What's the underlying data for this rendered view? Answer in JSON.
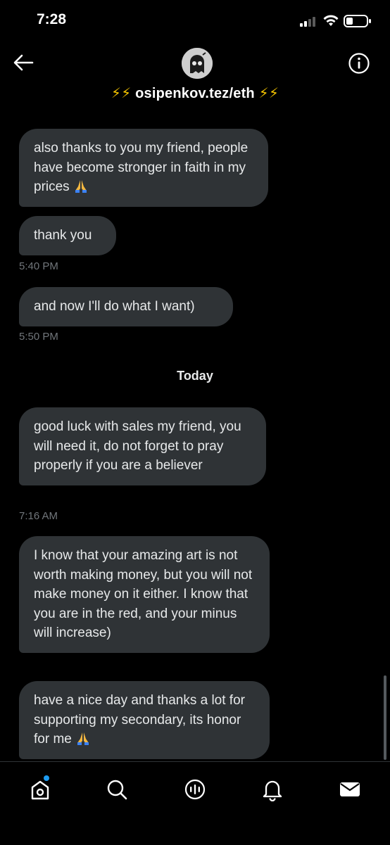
{
  "status_bar": {
    "time": "7:28"
  },
  "header": {
    "back_icon": "arrow-left-icon",
    "info_icon": "info-circle-icon",
    "title_emoji_left": "⚡⚡",
    "title_handle": "osipenkov.tez/eth",
    "title_emoji_right": "⚡⚡"
  },
  "messages": [
    {
      "text": "also thanks to you my friend, people have become stronger in faith in my prices",
      "emoji": "pray"
    },
    {
      "text": "thank you"
    },
    {
      "text": "and now I'll do what I want)"
    },
    {
      "text": "good luck with sales my friend, you will need it, do not forget to pray properly if you are a believer"
    },
    {
      "text": "I know that your amazing art is not worth making money, but you will not make money on it either. I know that you are in the red, and your minus will increase)"
    },
    {
      "text": "have a nice day and thanks a lot for supporting my secondary, its honor for me",
      "emoji": "pray"
    }
  ],
  "timestamps": {
    "t1": "5:40 PM",
    "t2": "5:50 PM",
    "t3": "7:16 AM"
  },
  "day_separator": "Today",
  "tabbar": {
    "items": [
      "home-icon",
      "search-icon",
      "spaces-icon",
      "notifications-icon",
      "messages-icon"
    ],
    "notification_color": "#1d9bf0"
  },
  "colors": {
    "background": "#000000",
    "bubble": "#2f3336",
    "secondary_text": "#71767b",
    "accent": "#1d9bf0",
    "bolt": "#f4c400"
  }
}
